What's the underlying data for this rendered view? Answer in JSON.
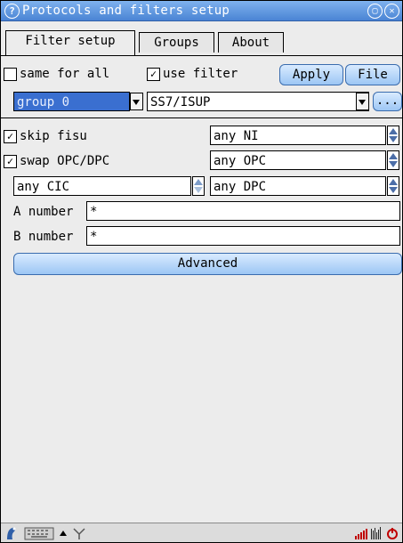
{
  "window": {
    "title": "Protocols and filters setup",
    "help_glyph": "?",
    "max_glyph": "▢",
    "close_glyph": "✕"
  },
  "tabs": [
    {
      "label": "Filter setup",
      "active": true
    },
    {
      "label": "Groups",
      "active": false
    },
    {
      "label": "About",
      "active": false
    }
  ],
  "top_row": {
    "same_for_all": {
      "label": "same for all",
      "checked": false
    },
    "use_filter": {
      "label": "use filter",
      "checked": true
    },
    "apply_label": "Apply",
    "file_label": "File"
  },
  "group_select": {
    "value": "group 0"
  },
  "protocol_select": {
    "value": "SS7/ISUP"
  },
  "more_button_label": "...",
  "filters": {
    "skip_fisu": {
      "label": "skip fisu",
      "checked": true
    },
    "swap_opc_dpc": {
      "label": "swap OPC/DPC",
      "checked": true
    },
    "ni_value": "any NI",
    "opc_value": "any OPC",
    "cic_value": "any CIC",
    "dpc_value": "any DPC"
  },
  "numbers": {
    "a_label": "A number",
    "a_value": "*",
    "b_label": "B number",
    "b_value": "*"
  },
  "advanced_label": "Advanced",
  "checkmark": "☑",
  "colors": {
    "titlebar": "#4a84d4",
    "button": "#9cc6f4",
    "selected": "#3a6fd0"
  },
  "taskbar": {
    "icons": [
      "start-icon",
      "keyboard-icon",
      "up-arrow-icon",
      "antenna-icon",
      "battery-icon",
      "signal-icon",
      "power-icon"
    ]
  }
}
